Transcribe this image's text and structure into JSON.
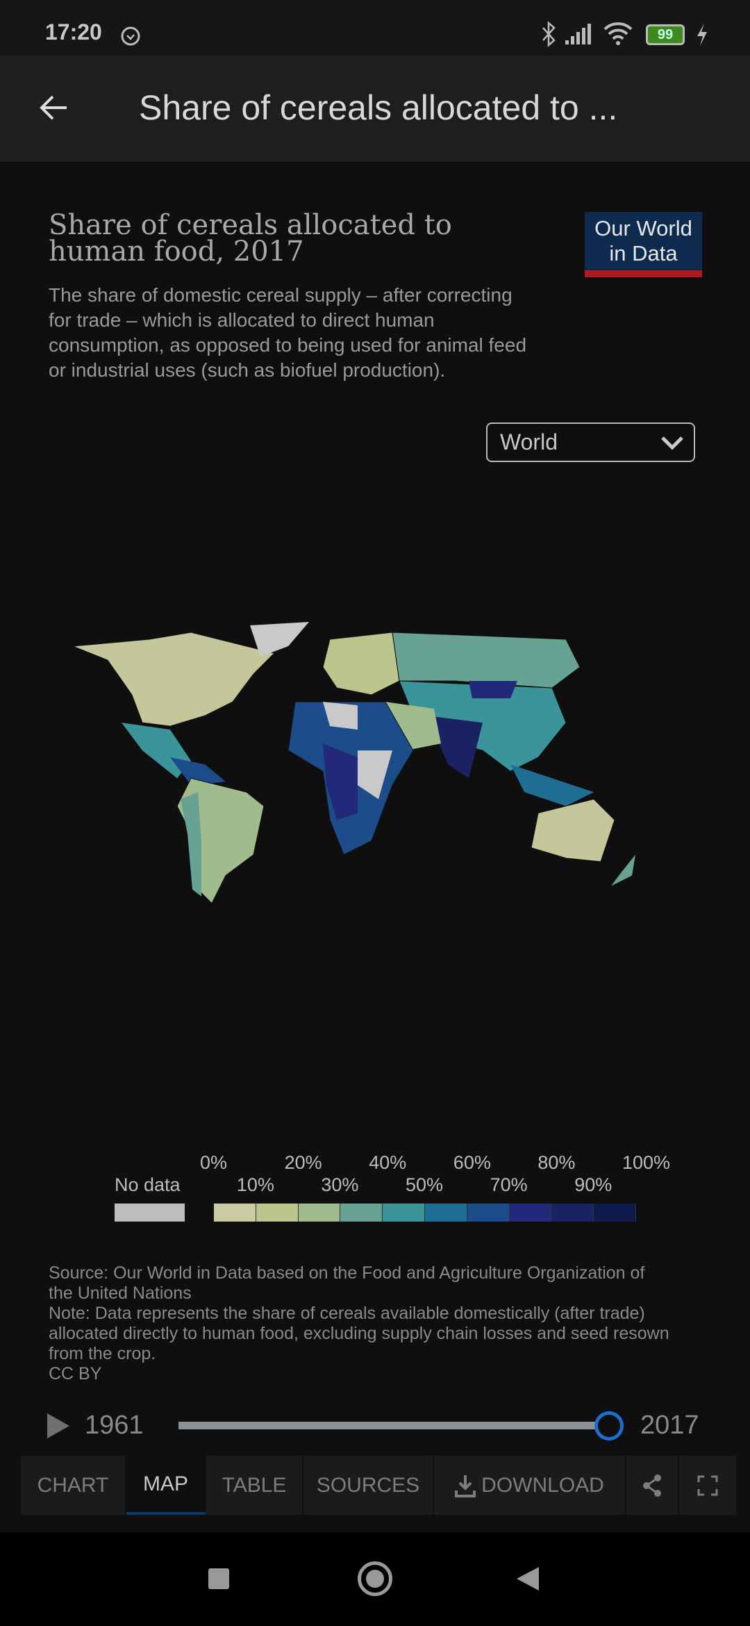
{
  "status_bar": {
    "time": "17:20",
    "battery": "99",
    "icons": [
      "alarm-icon",
      "bluetooth-icon",
      "signal-icon",
      "wifi-icon",
      "battery-icon",
      "charging-icon"
    ]
  },
  "header": {
    "title": "Share of cereals allocated to ...",
    "back_icon": "arrow-left-icon"
  },
  "chart": {
    "title": "Share of cereals allocated to human food, 2017",
    "subtitle": "The share of domestic cereal supply – after correcting for trade – which is allocated to direct human consumption, as opposed to being used for animal feed or industrial uses (such as biofuel production).",
    "logo": "Our World in Data",
    "region_select": "World",
    "legend": {
      "no_data": "No data",
      "no_data_color": "#bdbdbd",
      "top_labels": [
        "0%",
        "20%",
        "40%",
        "60%",
        "80%",
        "100%"
      ],
      "bottom_labels": [
        "10%",
        "30%",
        "50%",
        "70%",
        "90%"
      ],
      "colors": [
        "#c9cba3",
        "#bcc68c",
        "#a0bb8c",
        "#67a293",
        "#3b9499",
        "#1f6f95",
        "#1d4c8a",
        "#22297a",
        "#1b2263",
        "#0f1a4d"
      ]
    },
    "source": "Source: Our World in Data based on the Food and Agriculture Organization of the United Nations",
    "note": "Note: Data represents the share of cereals available domestically (after trade) allocated directly to human food, excluding supply chain losses and seed resown from the crop.",
    "license": "CC BY"
  },
  "timeline": {
    "start": "1961",
    "end": "2017",
    "position": 1.0,
    "accent": "#1a6fd0"
  },
  "tabs": [
    {
      "label": "CHART"
    },
    {
      "label": "MAP",
      "active": true
    },
    {
      "label": "TABLE"
    },
    {
      "label": "SOURCES"
    },
    {
      "label": "DOWNLOAD"
    }
  ],
  "tab_icons": [
    "share-icon",
    "fullscreen-icon"
  ]
}
